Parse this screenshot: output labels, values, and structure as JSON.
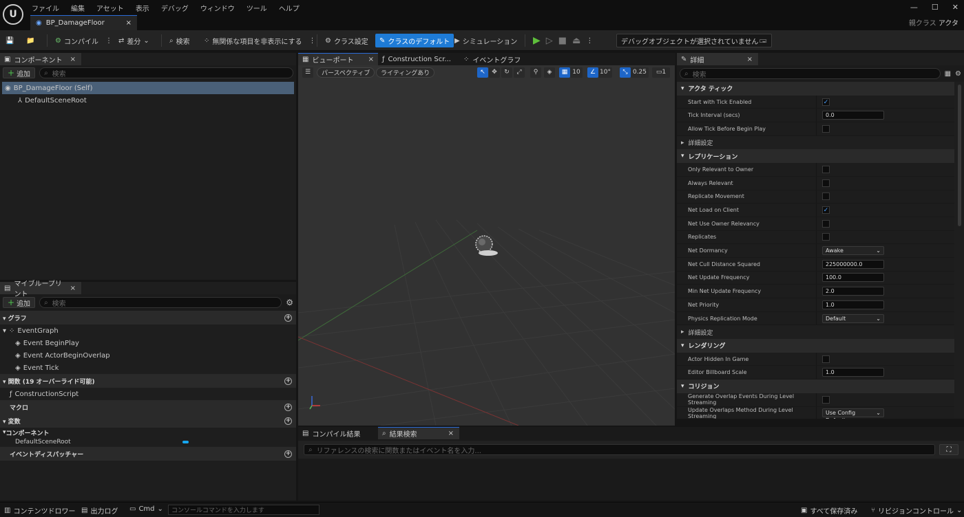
{
  "menu": [
    "ファイル",
    "編集",
    "アセット",
    "表示",
    "デバッグ",
    "ウィンドウ",
    "ツール",
    "ヘルプ"
  ],
  "doc_tab": {
    "title": "BP_DamageFloor",
    "close": "×"
  },
  "window_controls": {
    "minimize": "—",
    "maximize": "☐",
    "close": "✕"
  },
  "parent_class": {
    "label": "親クラス",
    "value": "アクタ"
  },
  "toolbar": {
    "compile": "コンパイル",
    "diff": "差分",
    "search": "検索",
    "hide_unrelated": "無関係な項目を非表示にする",
    "class_settings": "クラス設定",
    "class_defaults": "クラスのデフォルト",
    "simulation": "シミュレーション",
    "debug_object": "デバッグオブジェクトが選択されていません"
  },
  "components": {
    "tab": "コンポーネント",
    "add": "追加",
    "search_placeholder": "検索",
    "items": [
      "BP_DamageFloor (Self)",
      "DefaultSceneRoot"
    ]
  },
  "mybp": {
    "tab": "マイブループリント",
    "add": "追加",
    "search_placeholder": "検索",
    "graph_section": "グラフ",
    "event_graph": "EventGraph",
    "events": [
      "Event BeginPlay",
      "Event ActorBeginOverlap",
      "Event Tick"
    ],
    "functions_section": "関数 (19 オーバーライド可能)",
    "construction": "ConstructionScript",
    "macros_section": "マクロ",
    "variables_section": "変数",
    "components_sub": "コンポーネント",
    "default_root": "DefaultSceneRoot",
    "dispatchers_section": "イベントディスパッチャー"
  },
  "editor_tabs": {
    "viewport": "ビューポート",
    "construction": "Construction Scr...",
    "event_graph": "イベントグラフ"
  },
  "viewport": {
    "perspective": "パースペクティブ",
    "lighting": "ライティングあり",
    "grid": "10",
    "angle": "10°",
    "scale": "0.25",
    "cam": "1"
  },
  "details": {
    "tab": "詳細",
    "search_placeholder": "検索",
    "sections": {
      "actor_tick": "アクタ ティック",
      "advanced": "詳細設定",
      "replication": "レプリケーション",
      "rendering": "レンダリング",
      "collision": "コリジョン"
    },
    "tick": [
      {
        "name": "Start with Tick Enabled",
        "type": "check",
        "value": "✓"
      },
      {
        "name": "Tick Interval (secs)",
        "type": "input",
        "value": "0.0"
      },
      {
        "name": "Allow Tick Before Begin Play",
        "type": "check",
        "value": ""
      }
    ],
    "replication": [
      {
        "name": "Only Relevant to Owner",
        "type": "check",
        "value": ""
      },
      {
        "name": "Always Relevant",
        "type": "check",
        "value": ""
      },
      {
        "name": "Replicate Movement",
        "type": "check",
        "value": ""
      },
      {
        "name": "Net Load on Client",
        "type": "check",
        "value": "✓"
      },
      {
        "name": "Net Use Owner Relevancy",
        "type": "check",
        "value": ""
      },
      {
        "name": "Replicates",
        "type": "check",
        "value": ""
      },
      {
        "name": "Net Dormancy",
        "type": "drop",
        "value": "Awake"
      },
      {
        "name": "Net Cull Distance Squared",
        "type": "input",
        "value": "225000000.0"
      },
      {
        "name": "Net Update Frequency",
        "type": "input",
        "value": "100.0"
      },
      {
        "name": "Min Net Update Frequency",
        "type": "input",
        "value": "2.0"
      },
      {
        "name": "Net Priority",
        "type": "input",
        "value": "1.0"
      },
      {
        "name": "Physics Replication Mode",
        "type": "drop",
        "value": "Default"
      }
    ],
    "rendering": [
      {
        "name": "Actor Hidden In Game",
        "type": "check",
        "value": ""
      },
      {
        "name": "Editor Billboard Scale",
        "type": "input",
        "value": "1.0"
      }
    ],
    "collision": [
      {
        "name": "Generate Overlap Events During Level Streaming",
        "type": "check",
        "value": ""
      },
      {
        "name": "Update Overlaps Method During Level Streaming",
        "type": "drop",
        "value": "Use Config Default"
      }
    ]
  },
  "bottom": {
    "compile_results": "コンパイル結果",
    "find_results": "結果検索",
    "find_placeholder": "リファレンスの検索に関数またはイベント名を入力..."
  },
  "statusbar": {
    "content_drawer": "コンテンツドロワー",
    "output_log": "出力ログ",
    "cmd": "Cmd",
    "console_placeholder": "コンソールコマンドを入力します",
    "save_all": "すべて保存済み",
    "revision": "リビジョンコントロール"
  }
}
